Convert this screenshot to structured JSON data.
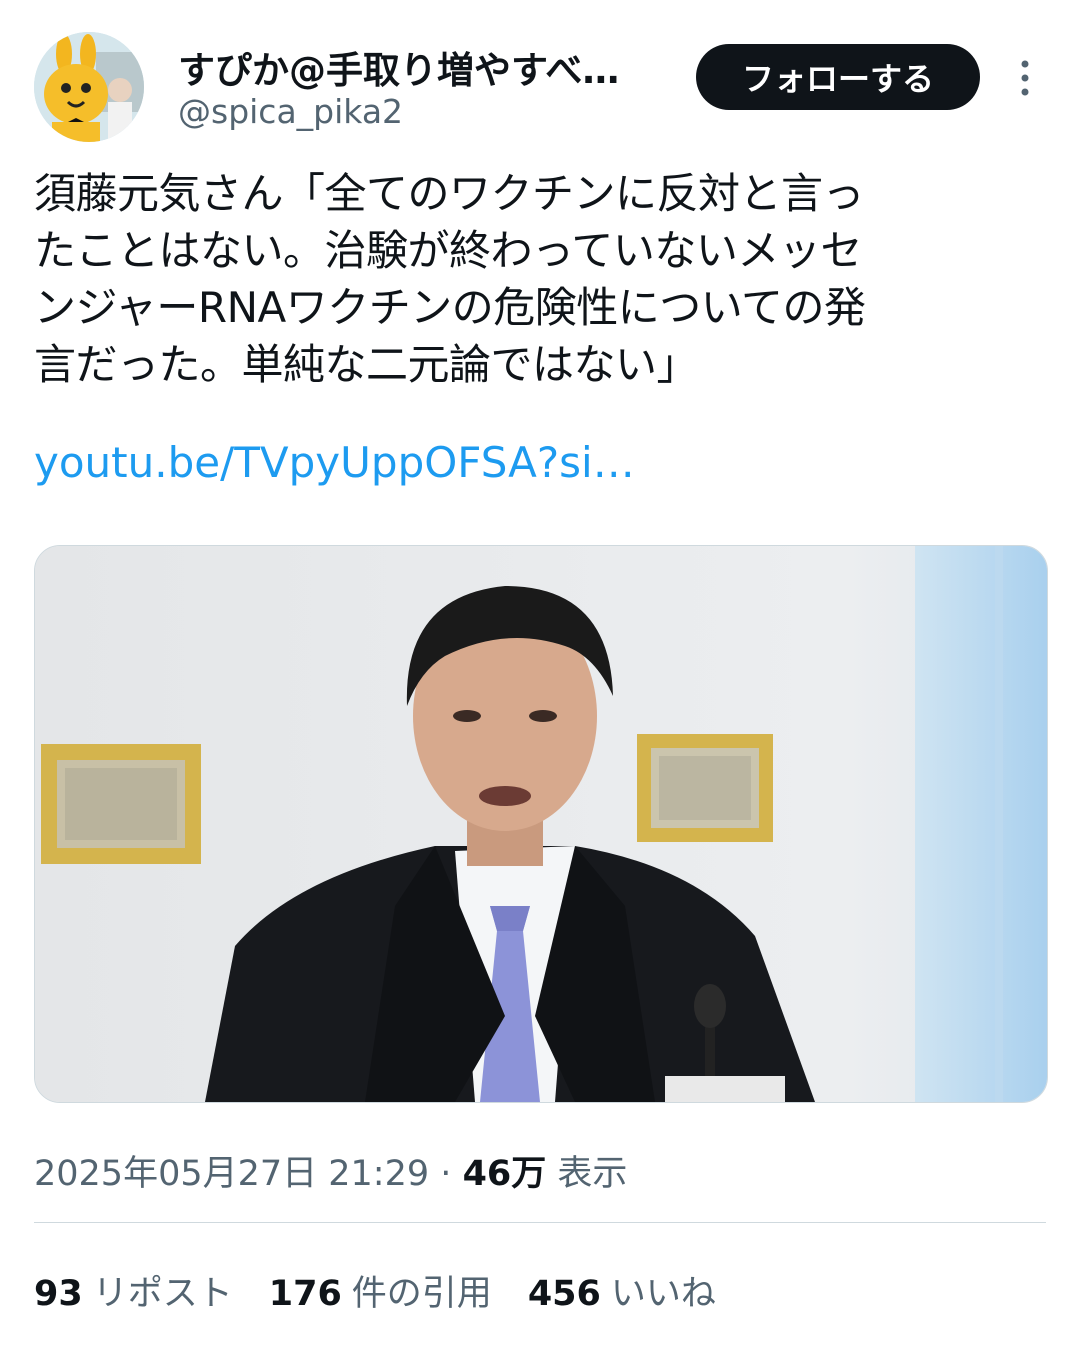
{
  "author": {
    "name": "すぴか@手取り増やすべ…",
    "handle": "@spica_pika2"
  },
  "follow_button": {
    "label": "フォローする"
  },
  "tweet": {
    "lines": [
      "須藤元気さん「全てのワクチンに反対と言っ",
      "たことはない。治験が終わっていないメッセ",
      "ンジャーRNAワクチンの危険性についての発",
      "言だった。単純な二元論ではない」"
    ],
    "link": "youtu.be/TVpyUppOFSA?si…"
  },
  "meta": {
    "timestamp": "2025年05月27日 21:29",
    "separator": "·",
    "views_count": "46万",
    "views_label": "表示"
  },
  "stats": {
    "reposts_count": "93",
    "reposts_label": "リポスト",
    "quotes_count": "176",
    "quotes_label": "件の引用",
    "likes_count": "456",
    "likes_label": "いいね"
  },
  "icons": {
    "more": "more-vertical-icon"
  }
}
